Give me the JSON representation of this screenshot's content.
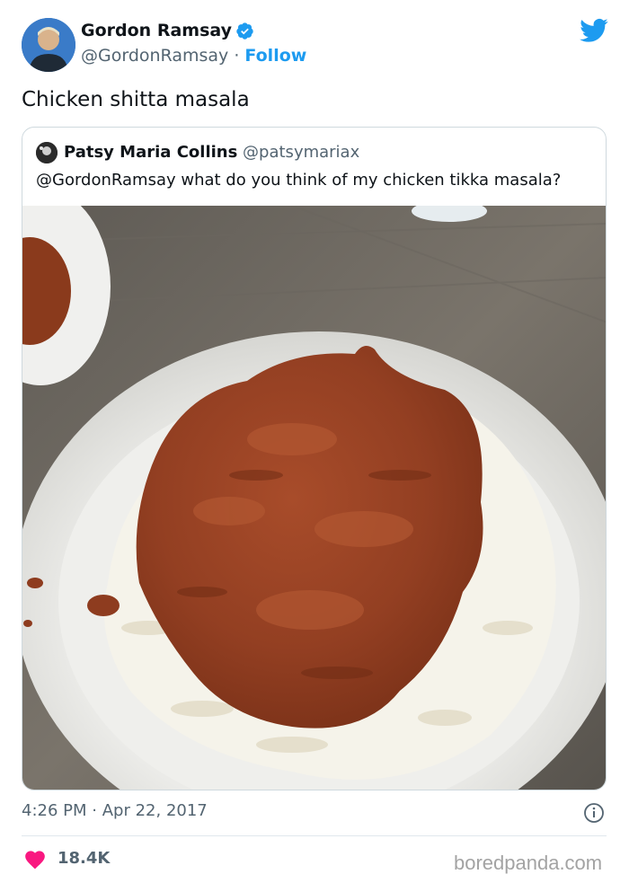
{
  "tweet": {
    "author_name": "Gordon Ramsay",
    "author_handle": "@GordonRamsay",
    "separator": "·",
    "follow_label": "Follow",
    "text": "Chicken shitta masala",
    "time": "4:26 PM",
    "date": "Apr 22, 2017",
    "like_count": "18.4K"
  },
  "quoted": {
    "author_name": "Patsy Maria Collins",
    "author_handle": "@patsymariax",
    "text": "@GordonRamsay what do you think of my chicken tikka masala?"
  },
  "icons": {
    "verified": "verified-badge-icon",
    "brand": "twitter-bird-icon",
    "info": "info-icon",
    "like": "heart-icon"
  },
  "colors": {
    "accent": "#1d9bf0",
    "like": "#f91880",
    "muted": "#536471"
  },
  "watermark": "boredpanda.com"
}
